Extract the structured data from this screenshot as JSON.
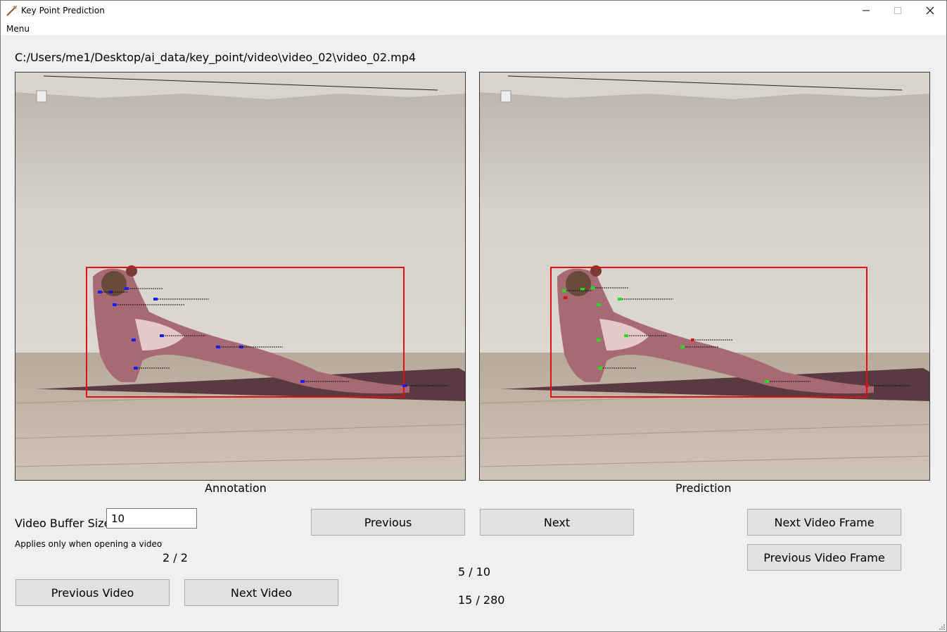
{
  "window": {
    "title": "Key Point Prediction",
    "minimize_glyph": "—",
    "maximize_glyph": "☐",
    "close_glyph": "✕"
  },
  "menu": {
    "label": "Menu"
  },
  "file_path": "C:/Users/me1/Desktop/ai_data/key_point/video\\video_02\\video_02.mp4",
  "panels": {
    "annotation_caption": "Annotation",
    "prediction_caption": "Prediction",
    "annotation_marker_color": "#1a1aff",
    "prediction_marker_color": "#22dd22",
    "bbox_color": "#e01010"
  },
  "buffer": {
    "label": "Video Buffer Size",
    "value": "10",
    "hint": "Applies only when opening a video"
  },
  "counters": {
    "video_index": "2 / 2",
    "buffer_frame": "5 / 10",
    "frame_index": "15 / 280"
  },
  "buttons": {
    "previous": "Previous",
    "next": "Next",
    "next_video_frame": "Next Video Frame",
    "previous_video_frame": "Previous Video Frame",
    "previous_video": "Previous Video",
    "next_video": "Next Video"
  }
}
